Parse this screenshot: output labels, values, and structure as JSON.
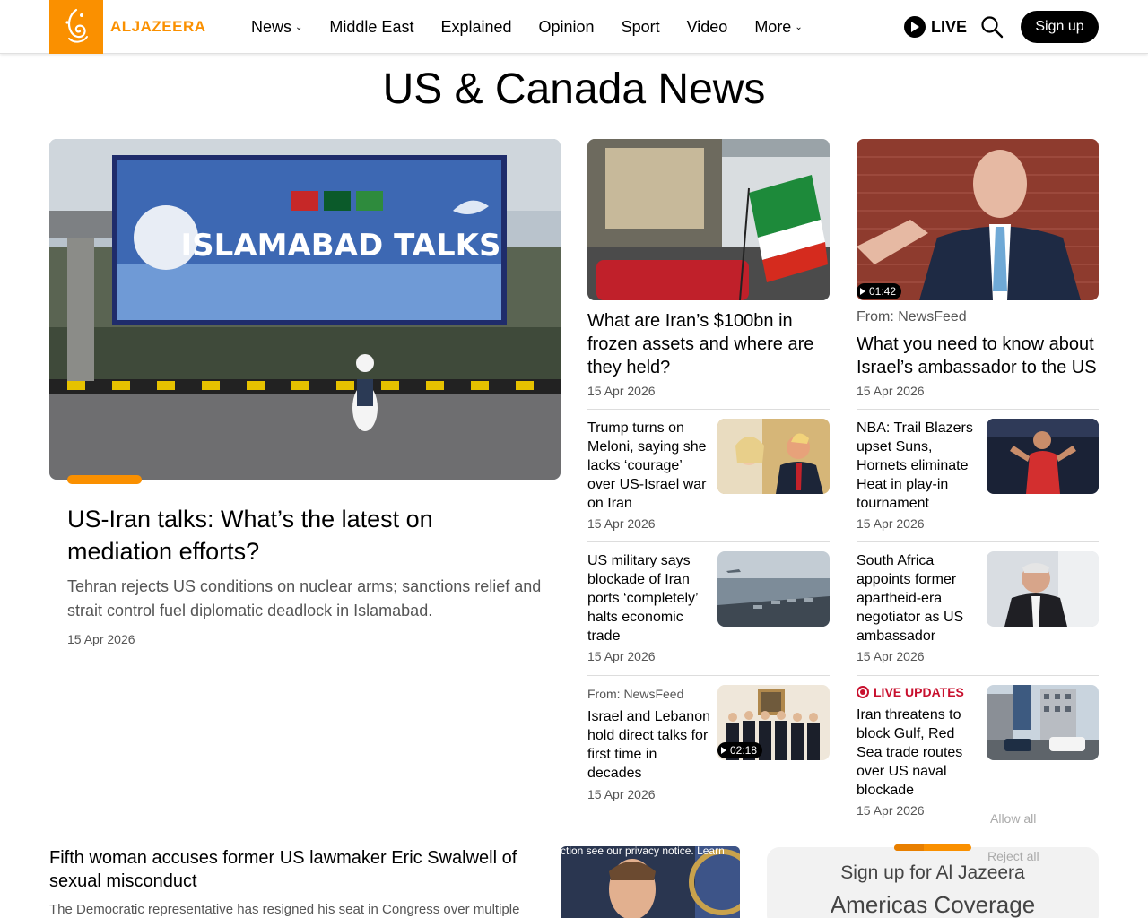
{
  "header": {
    "logo_text": "ALJAZEERA",
    "nav": [
      {
        "label": "News",
        "dropdown": true
      },
      {
        "label": "Middle East",
        "dropdown": false
      },
      {
        "label": "Explained",
        "dropdown": false
      },
      {
        "label": "Opinion",
        "dropdown": false
      },
      {
        "label": "Sport",
        "dropdown": false
      },
      {
        "label": "Video",
        "dropdown": false
      },
      {
        "label": "More",
        "dropdown": true
      }
    ],
    "live_label": "LIVE",
    "signup_label": "Sign up"
  },
  "page_title": "US & Canada News",
  "hero": {
    "image_text": "ISLAMABAD TALKS",
    "title": "US-Iran talks: What’s the latest on mediation efforts?",
    "summary": "Tehran rejects US conditions on nuclear arms; sanctions relief and strait control fuel diplomatic deadlock in Islamabad.",
    "date": "15 Apr 2026"
  },
  "featured": [
    {
      "title": "What are Iran’s $100bn in frozen assets and where are they held?",
      "date": "15 Apr 2026"
    },
    {
      "from": "From: NewsFeed",
      "title": "What you need to know about Israel’s ambassador to the US",
      "date": "15 Apr 2026",
      "video_duration": "01:42"
    }
  ],
  "col2_items": [
    {
      "title": "Trump turns on Meloni, saying she lacks ‘courage’ over US-Israel war on Iran",
      "date": "15 Apr 2026"
    },
    {
      "title": "US military says blockade of Iran ports ‘completely’ halts economic trade",
      "date": "15 Apr 2026"
    },
    {
      "from": "From: NewsFeed",
      "title": "Israel and Lebanon hold direct talks for first time in decades",
      "date": "15 Apr 2026",
      "video_duration": "02:18"
    }
  ],
  "col3_items": [
    {
      "title": "NBA: Trail Blazers upset Suns, Hornets eliminate Heat in play-in tournament",
      "date": "15 Apr 2026"
    },
    {
      "title": "South Africa appoints former apartheid-era negotiator as US ambassador",
      "date": "15 Apr 2026"
    },
    {
      "live_label": "LIVE UPDATES",
      "title": "Iran threatens to block Gulf, Red Sea trade routes over US naval blockade",
      "date": "15 Apr 2026"
    }
  ],
  "bottom": {
    "title": "Fifth woman accuses former US lawmaker Eric Swalwell of sexual misconduct",
    "summary": "The Democratic representative has resigned his seat in Congress over multiple"
  },
  "consent": {
    "allow_all": "Allow all",
    "reject_all": "Reject all",
    "privacy_text": "ction see our privacy notice. Learn"
  },
  "newsletter": {
    "line1": "Sign up for Al Jazeera",
    "line2": "Americas Coverage"
  },
  "colors": {
    "brand": "#fa9000",
    "live_red": "#c8102e"
  }
}
